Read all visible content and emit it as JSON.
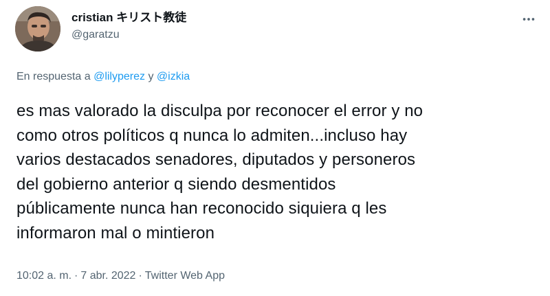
{
  "author": {
    "display_name": "cristian キリスト教徒",
    "handle": "@garatzu"
  },
  "reply_context": {
    "prefix": "En respuesta a",
    "mention_1": "@lilyperez",
    "conjunction": "y",
    "mention_2": "@izkia"
  },
  "tweet_lines": [
    "es mas valorado la disculpa por reconocer el error y no",
    "como otros políticos q nunca lo admiten...incluso hay",
    "varios destacados senadores, diputados y personeros",
    "del gobierno anterior q siendo desmentidos",
    "públicamente nunca han reconocido siquiera q les",
    "informaron mal o mintieron"
  ],
  "meta": {
    "time": "10:02 a. m.",
    "separator": "·",
    "date": "7 abr. 2022",
    "source": "Twitter Web App"
  },
  "icons": {
    "more": "more-horizontal-icon",
    "avatar": "avatar-photo"
  },
  "colors": {
    "text_primary": "#0f1419",
    "text_secondary": "#536471",
    "link": "#1d9bf0"
  }
}
